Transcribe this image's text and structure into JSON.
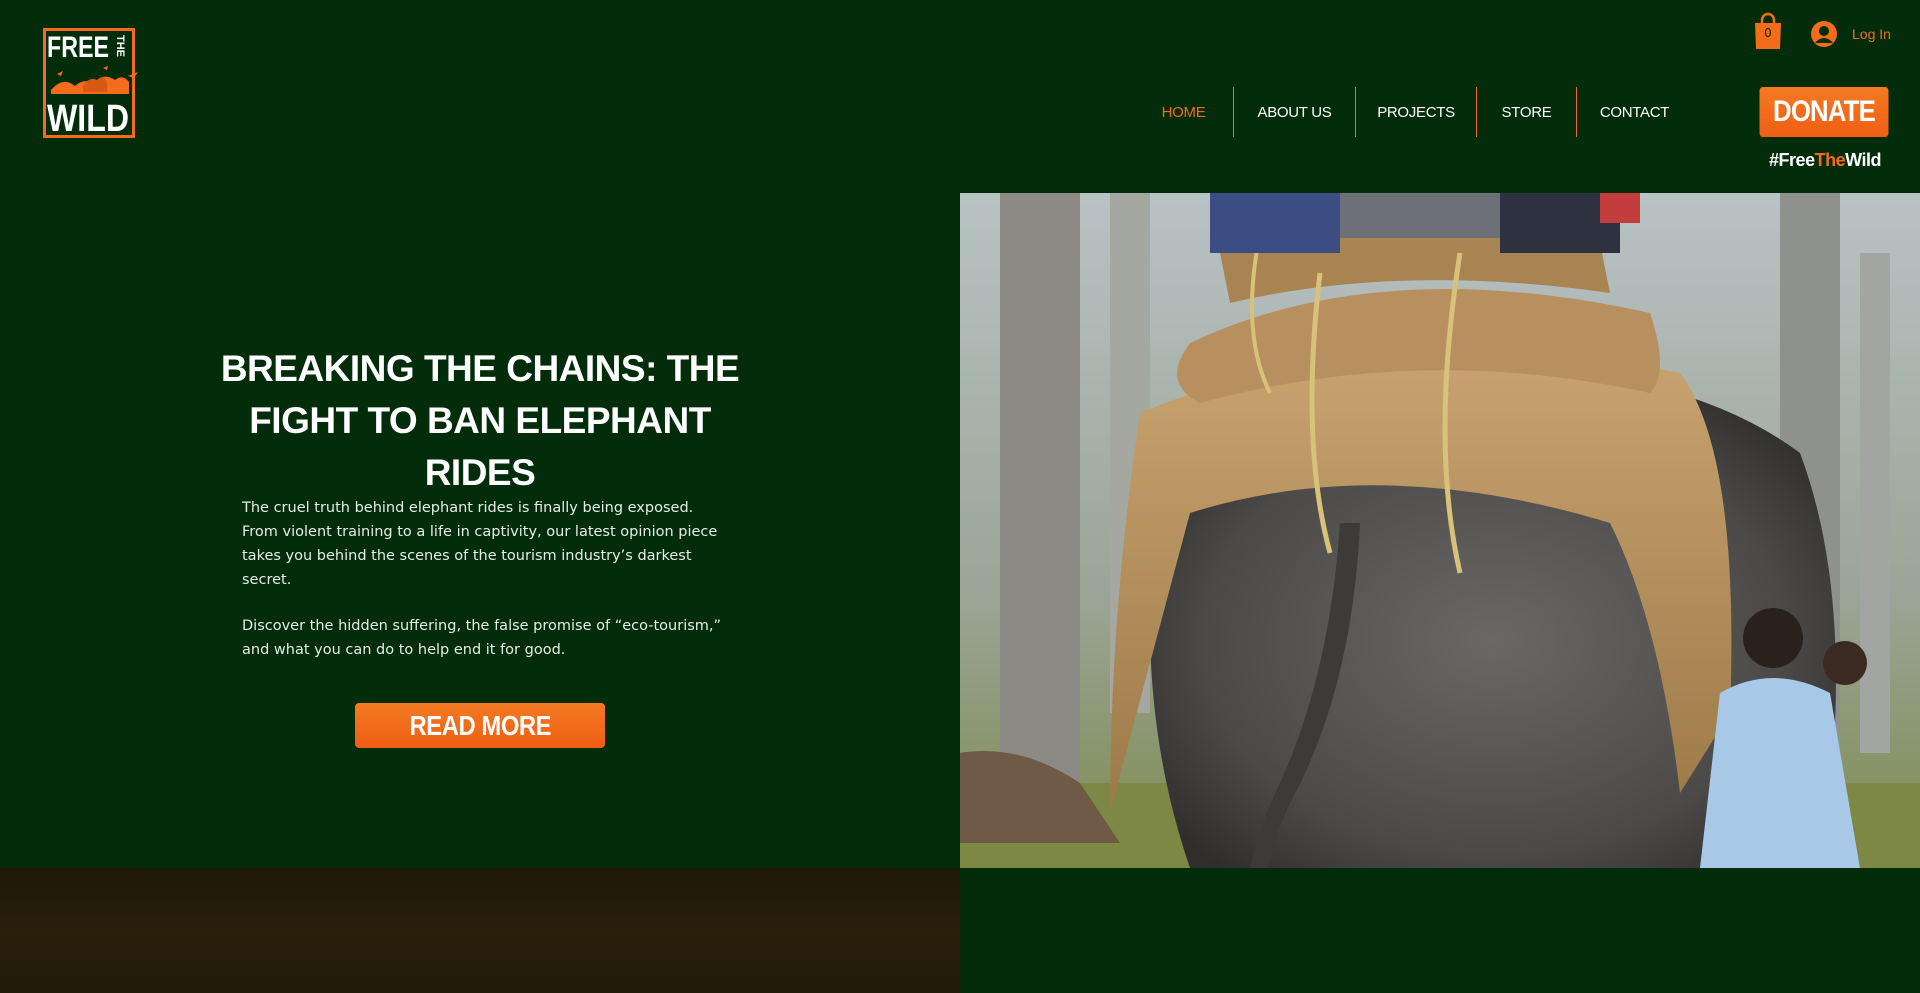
{
  "brand": {
    "logo_line1": "FREE",
    "logo_line2": "THE",
    "logo_line3": "WILD",
    "accent_color": "#f26c1c",
    "background_color": "#032d0a"
  },
  "header": {
    "cart_count": "0",
    "login_label": "Log In",
    "nav": [
      {
        "label": "HOME",
        "active": true
      },
      {
        "label": "ABOUT US",
        "active": false
      },
      {
        "label": "PROJECTS",
        "active": false
      },
      {
        "label": "STORE",
        "active": false
      },
      {
        "label": "CONTACT",
        "active": false
      }
    ],
    "donate_label": "DONATE",
    "hashtag_prefix": "#Free",
    "hashtag_accent": "The",
    "hashtag_suffix": "Wild"
  },
  "hero": {
    "title": "BREAKING THE CHAINS: THE FIGHT TO BAN ELEPHANT RIDES",
    "paragraph_1": "The cruel truth behind elephant rides is finally being exposed. From violent training to a life in captivity, our latest opinion piece takes you behind the scenes of the tourism industry’s darkest secret.",
    "paragraph_2": "Discover the hidden suffering, the false promise of “eco-tourism,” and what you can do to help end it for good.",
    "cta_label": "READ MORE"
  }
}
